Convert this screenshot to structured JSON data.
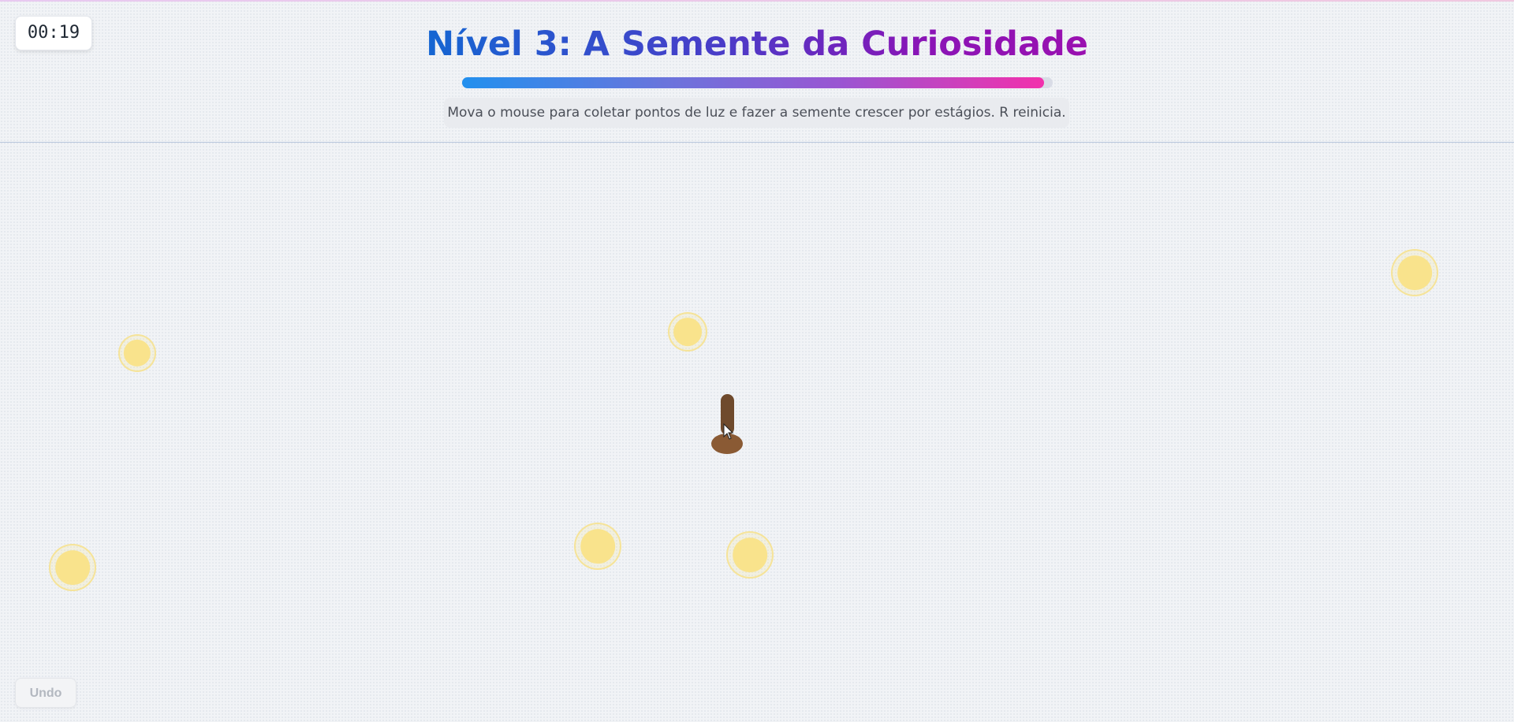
{
  "level": {
    "title": "Nível 3: A Semente da Curiosidade",
    "progress": 0.985,
    "instructions": "Mova o mouse para coletar pontos de luz e fazer a semente crescer por estágios. R reinicia."
  },
  "timer": "00:19",
  "controls": {
    "undo_label": "Undo"
  },
  "light_points_count": 6
}
